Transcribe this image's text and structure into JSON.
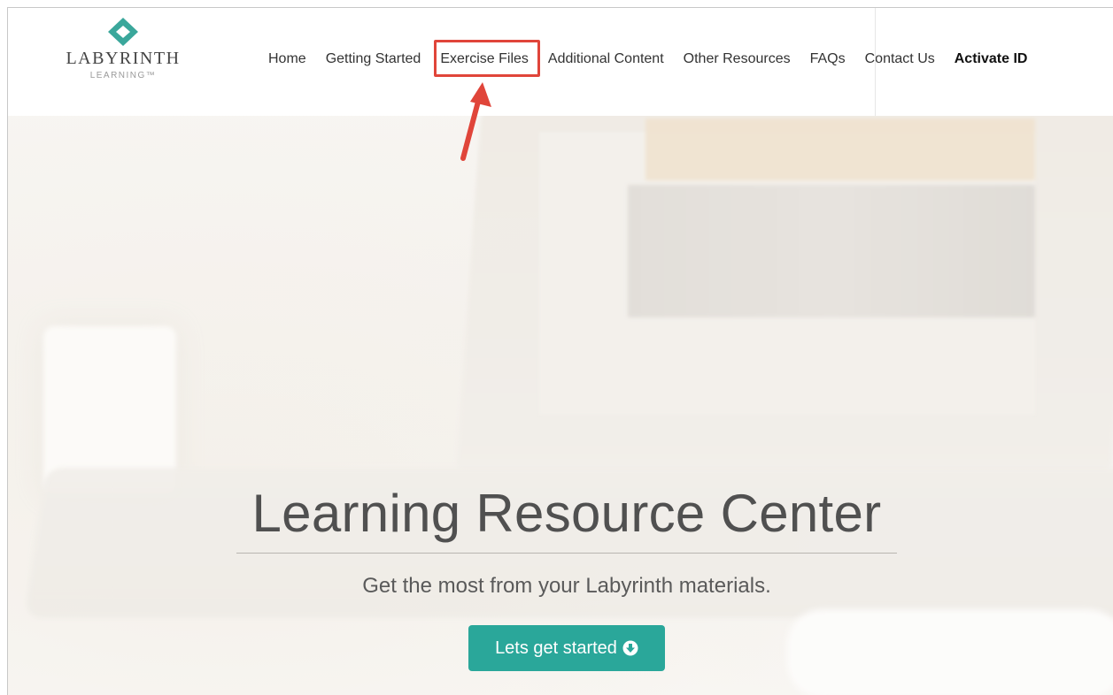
{
  "brand": {
    "name": "LABYRINTH",
    "subtitle": "LEARNING™",
    "accent_color": "#3aa79b"
  },
  "nav": {
    "items": [
      {
        "label": "Home"
      },
      {
        "label": "Getting Started"
      },
      {
        "label": "Exercise Files",
        "highlighted": true
      },
      {
        "label": "Additional Content"
      },
      {
        "label": "Other Resources"
      },
      {
        "label": "FAQs"
      },
      {
        "label": "Contact Us"
      },
      {
        "label": "Activate ID",
        "bold": true
      }
    ],
    "highlight_color": "#e0453a"
  },
  "hero": {
    "title": "Learning Resource Center",
    "subtitle": "Get the most from your Labyrinth materials.",
    "cta_label": "Lets get started",
    "cta_icon": "circle-arrow-down-icon",
    "cta_color": "#2aa79a"
  },
  "annotation": {
    "arrow_icon": "red-arrow-pointer-icon",
    "target": "Exercise Files"
  }
}
